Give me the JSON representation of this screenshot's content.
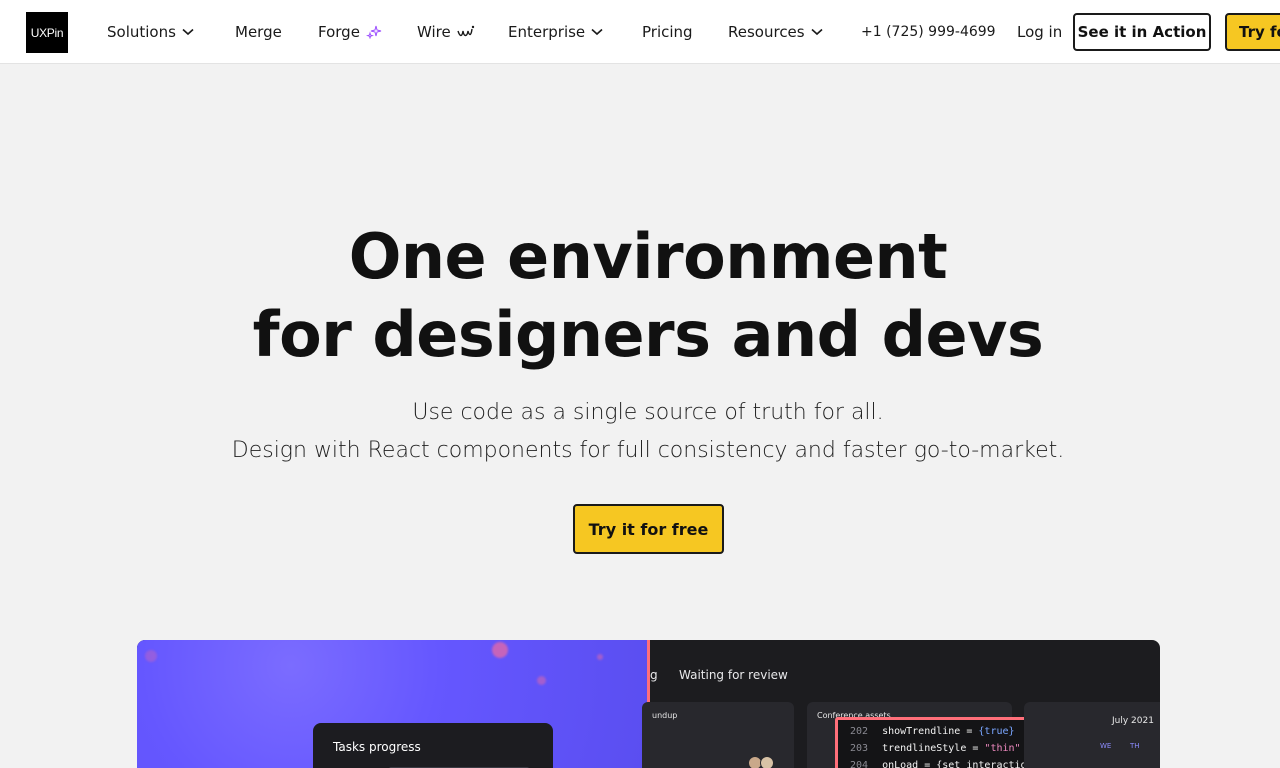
{
  "nav": {
    "logo": "UXPin",
    "items": [
      {
        "label": "Solutions",
        "has_dropdown": true
      },
      {
        "label": "Merge",
        "has_dropdown": false
      },
      {
        "label": "Forge",
        "icon": "sparkle-icon"
      },
      {
        "label": "Wire",
        "icon": "squiggle-icon"
      },
      {
        "label": "Enterprise",
        "has_dropdown": true
      },
      {
        "label": "Pricing",
        "has_dropdown": false
      },
      {
        "label": "Resources",
        "has_dropdown": true
      }
    ],
    "phone": "+1 (725) 999-4699",
    "login": "Log in",
    "demo_button": "See it in Action",
    "try_button": "Try for free"
  },
  "hero": {
    "title_line1": "One environment",
    "title_line2": "for designers and devs",
    "subtitle_line1": "Use code as a single source of truth for all.",
    "subtitle_line2": "Design with React components for full consistency and faster go-to-market.",
    "cta": "Try it for free"
  },
  "showcase": {
    "tasks_title": "Tasks progress",
    "tab_partial": "g",
    "tab_waiting": "Waiting for review",
    "col1_title": "undup",
    "col2_title": "Conference assets",
    "code_lines": [
      {
        "num": "202",
        "key": "showTrendline",
        "op": " = ",
        "val": "{true}",
        "val_type": "kw"
      },
      {
        "num": "203",
        "key": "trendlineStyle",
        "op": " = ",
        "val": "\"thin\"",
        "val_type": "str"
      },
      {
        "num": "204",
        "key": "onLoad",
        "op": " = ",
        "val": "{set interaction}",
        "val_type": "plain"
      }
    ],
    "calendar_title": "July 2021",
    "calendar_days": [
      "WE",
      "TH"
    ]
  },
  "colors": {
    "accent_yellow": "#f6c722",
    "purple": "#6557ff",
    "highlight_red": "#ff6f7a"
  }
}
